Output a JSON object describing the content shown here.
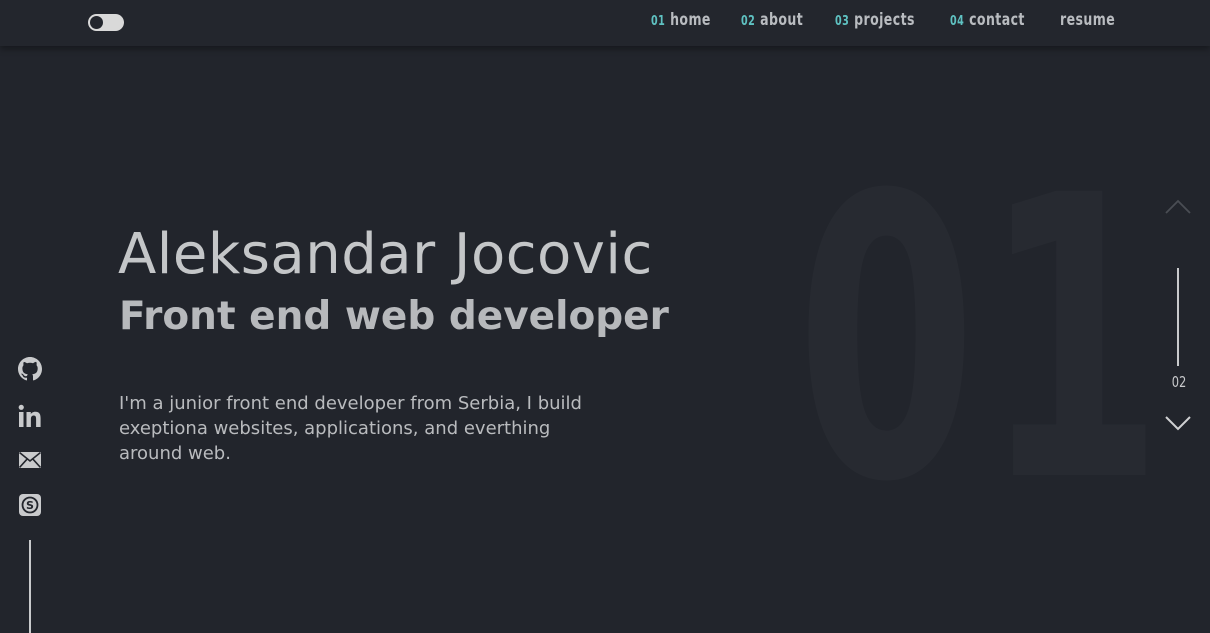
{
  "nav": {
    "items": [
      {
        "num": "01",
        "label": "home"
      },
      {
        "num": "02",
        "label": "about"
      },
      {
        "num": "03",
        "label": "projects"
      },
      {
        "num": "04",
        "label": "contact"
      }
    ],
    "resume_label": "resume"
  },
  "hero": {
    "background_number": "01",
    "name": "Aleksandar Jocovic",
    "role": "Front end web developer",
    "bio": "I'm a junior front end developer from Serbia, I build exeptiona websites, applications, and everthing around web."
  },
  "social": {
    "icons": [
      "github-icon",
      "linkedin-icon",
      "mail-icon",
      "skype-icon"
    ]
  },
  "pager": {
    "next_page": "02"
  },
  "colors": {
    "background": "#22252c",
    "topbar": "#23262d",
    "accent": "#5fc2c2",
    "text": "#c4c6c8"
  }
}
